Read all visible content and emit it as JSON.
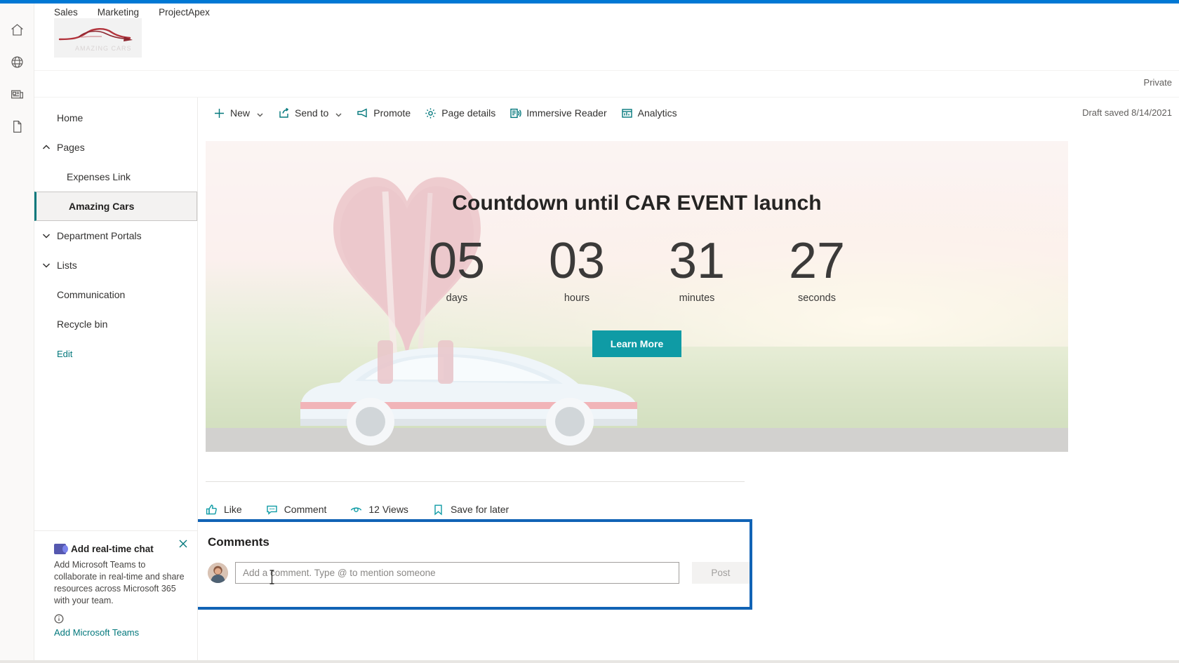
{
  "top_nav": [
    {
      "label": "Sales"
    },
    {
      "label": "Marketing"
    },
    {
      "label": "ProjectApex"
    }
  ],
  "site": {
    "logo_name": "amazing-cars-logo"
  },
  "privacy": {
    "label": "Private"
  },
  "icon_rail": [
    {
      "name": "home-icon"
    },
    {
      "name": "globe-icon"
    },
    {
      "name": "news-icon"
    },
    {
      "name": "document-icon"
    }
  ],
  "sidebar": {
    "items": [
      {
        "label": "Home",
        "level": "top",
        "chevron": "none",
        "selected": false
      },
      {
        "label": "Pages",
        "level": "top",
        "chevron": "up",
        "selected": false
      },
      {
        "label": "Expenses Link",
        "level": "child",
        "chevron": "none",
        "selected": false
      },
      {
        "label": "Amazing Cars",
        "level": "child",
        "chevron": "none",
        "selected": true
      },
      {
        "label": "Department Portals",
        "level": "top",
        "chevron": "down",
        "selected": false
      },
      {
        "label": "Lists",
        "level": "top",
        "chevron": "down",
        "selected": false
      },
      {
        "label": "Communication",
        "level": "top",
        "chevron": "none",
        "selected": false
      },
      {
        "label": "Recycle bin",
        "level": "top",
        "chevron": "none",
        "selected": false
      }
    ],
    "edit_label": "Edit"
  },
  "teams_card": {
    "title": "Add real-time chat",
    "body": "Add Microsoft Teams to collaborate in real-time and share resources across Microsoft 365 with your team.",
    "link_label": "Add Microsoft Teams"
  },
  "command_bar": {
    "items": [
      {
        "label": "New",
        "icon": "plus-icon",
        "caret": true
      },
      {
        "label": "Send to",
        "icon": "send-to-icon",
        "caret": true
      },
      {
        "label": "Promote",
        "icon": "promote-icon",
        "caret": false
      },
      {
        "label": "Page details",
        "icon": "gear-icon",
        "caret": false
      },
      {
        "label": "Immersive Reader",
        "icon": "immersive-reader-icon",
        "caret": false
      },
      {
        "label": "Analytics",
        "icon": "analytics-icon",
        "caret": false
      }
    ],
    "draft_status": "Draft saved 8/14/2021"
  },
  "hero": {
    "title": "Countdown until CAR EVENT launch",
    "units": [
      {
        "value": "05",
        "label": "days"
      },
      {
        "value": "03",
        "label": "hours"
      },
      {
        "value": "31",
        "label": "minutes"
      },
      {
        "value": "27",
        "label": "seconds"
      }
    ],
    "button_label": "Learn More",
    "button_color": "#0f9ba5"
  },
  "social": [
    {
      "label": "Like",
      "icon": "thumbs-up-icon"
    },
    {
      "label": "Comment",
      "icon": "comment-icon"
    },
    {
      "label": "12 Views",
      "icon": "eye-icon"
    },
    {
      "label": "Save for later",
      "icon": "bookmark-icon"
    }
  ],
  "comments": {
    "heading": "Comments",
    "placeholder": "Add a comment. Type @ to mention someone",
    "value": "",
    "post_label": "Post",
    "highlight_color": "#1163b5"
  }
}
